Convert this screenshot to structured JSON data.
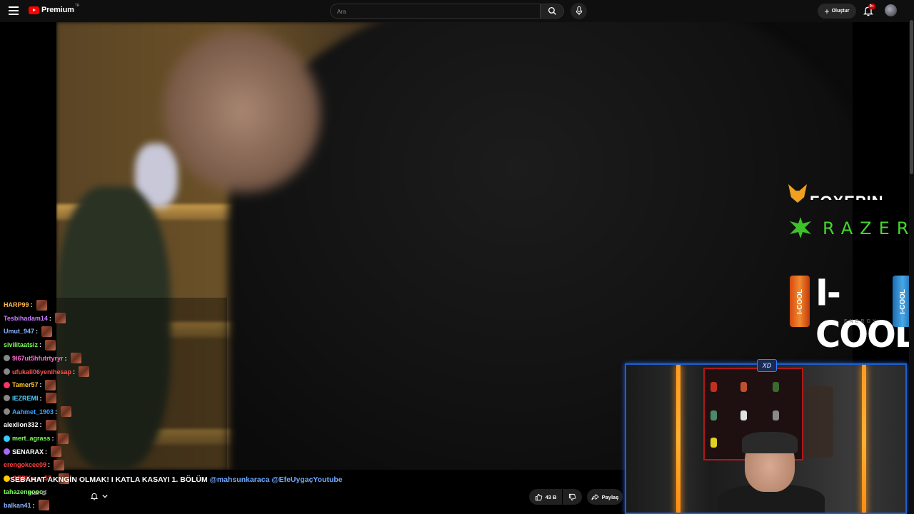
{
  "header": {
    "logo_text": "Premium",
    "logo_tr": "TR",
    "search_placeholder": "Ara",
    "create_label": "Oluştur",
    "notification_count": "9+"
  },
  "video": {
    "title_prefix": "SEBAHAT AK",
    "title_main": "NGİN OLMAK! I KATLA KASAYI 1. BÖLÜM",
    "mention1": "@mahsunkaracа",
    "mention2": "@EfeUygaçYoutube",
    "channel_name": "mak",
    "likes": "43 B",
    "share_label": "Paylaş"
  },
  "sponsors": {
    "foxepin": "FOXEPIN",
    "razer": "RAZER",
    "icool": "I-COOL",
    "icool_can": "I-COOL",
    "icool_sub": "ENERGY"
  },
  "chat": [
    {
      "name": "HARP99",
      "color": "#ffb84d",
      "badge": "",
      "emote": true
    },
    {
      "name": "Tesbihadam14",
      "color": "#c77dff",
      "badge": "",
      "emote": true
    },
    {
      "name": "Umut_947",
      "color": "#8ab4ff",
      "badge": "",
      "emote": true
    },
    {
      "name": "sivilitaatsiz",
      "color": "#7dff5a",
      "badge": "",
      "emote": true
    },
    {
      "name": "9l67ut5hfutrtyryr",
      "color": "#ff6bd6",
      "badge": "#888",
      "emote": true
    },
    {
      "name": "ufukali06yenihesap",
      "color": "#ff5050",
      "badge": "#888",
      "emote": true
    },
    {
      "name": "Tamer57",
      "color": "#ffcc33",
      "badge": "#ff3366",
      "emote": true
    },
    {
      "name": "IEZREMI",
      "color": "#4dd2ff",
      "badge": "#888",
      "emote": true
    },
    {
      "name": "Aahmet_1903",
      "color": "#3da5ff",
      "badge": "#888",
      "emote": true
    },
    {
      "name": "alexlion332",
      "color": "#ffffff",
      "badge": "",
      "emote": true
    },
    {
      "name": "mert_agrass",
      "color": "#7dff5a",
      "badge": "#33ccff",
      "emote": true
    },
    {
      "name": "SENARAX",
      "color": "#ffffff",
      "badge": "#aa66ff",
      "emote": true
    },
    {
      "name": "erengokcee09",
      "color": "#ff4040",
      "badge": "",
      "emote": true
    },
    {
      "name": "GEBKeran57",
      "color": "#ff4040",
      "badge": "#ffcc00",
      "emote": true
    },
    {
      "name": "tahazengooo",
      "color": "#7dff5a",
      "badge": "",
      "emote": false
    },
    {
      "name": "balkan41",
      "color": "#8ab4ff",
      "badge": "",
      "emote": true
    }
  ]
}
